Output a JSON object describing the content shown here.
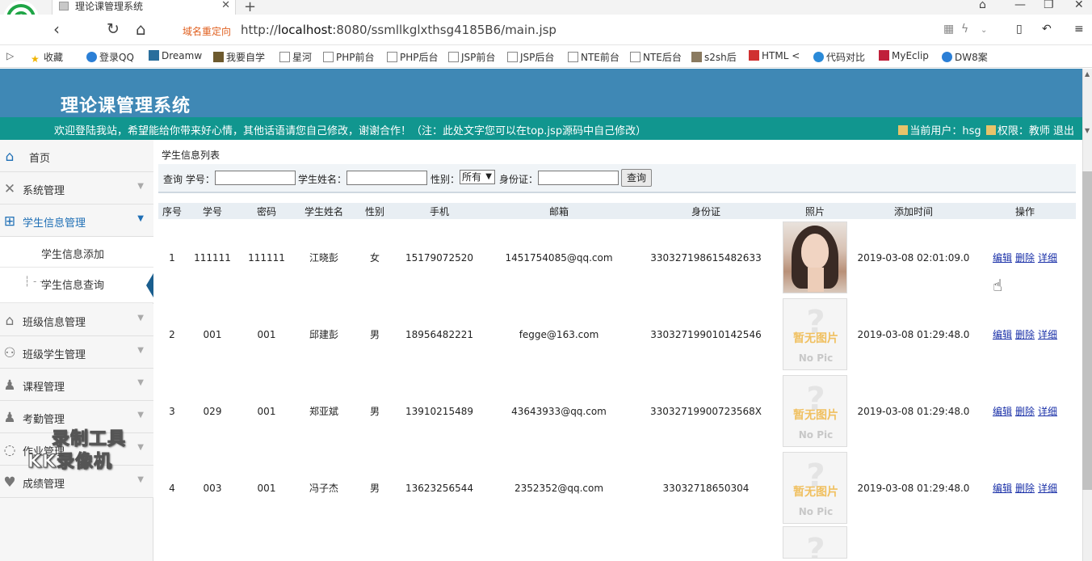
{
  "browser": {
    "tab_title": "理论课管理系统",
    "redirect_label": "域名重定向",
    "url_prefix": "http://",
    "url_host": "localhost",
    "url_rest": ":8080/ssmllkglxthsg4185B6/main.jsp",
    "bookmarks": [
      "收藏",
      "登录QQ",
      "Dreamw",
      "我要自学",
      "星河",
      "PHP前台",
      "PHP后台",
      "JSP前台",
      "JSP后台",
      "NTE前台",
      "NTE后台",
      "s2sh后",
      "HTML <",
      "代码对比",
      "MyEclip",
      "DW8案"
    ]
  },
  "header": {
    "title": "理论课管理系统",
    "welcome": "欢迎登陆我站，希望能给你带来好心情，其他话语请您自己修改，谢谢合作！（注：此处文字您可以在top.jsp源码中自己修改）",
    "current_user_label": "当前用户：hsg",
    "role_label": "权限：教师",
    "logout": "退出"
  },
  "sidebar": {
    "home": "首页",
    "items": [
      {
        "label": "系统管理",
        "icon": "tools-icon"
      },
      {
        "label": "学生信息管理",
        "icon": "grid-icon",
        "active": true
      },
      {
        "label": "班级信息管理",
        "icon": "home-icon"
      },
      {
        "label": "班级学生管理",
        "icon": "user-icon"
      },
      {
        "label": "课程管理",
        "icon": "person-icon"
      },
      {
        "label": "考勤管理",
        "icon": "person-icon"
      },
      {
        "label": "作业管理",
        "icon": "chat-icon"
      },
      {
        "label": "成绩管理",
        "icon": "heart-icon"
      }
    ],
    "subitems": [
      "学生信息添加",
      "学生信息查询"
    ],
    "watermark": [
      "录制工具",
      "KK录像机"
    ]
  },
  "main": {
    "list_title": "学生信息列表",
    "search": {
      "query_label": "查询 学号：",
      "name_label": "学生姓名：",
      "gender_label": "性别：",
      "gender_value": "所有",
      "id_label": "身份证：",
      "button": "查询"
    },
    "columns": [
      "序号",
      "学号",
      "密码",
      "学生姓名",
      "性别",
      "手机",
      "邮箱",
      "身份证",
      "照片",
      "添加时间",
      "操作"
    ],
    "rows": [
      {
        "no": "1",
        "sid": "111111",
        "pwd": "111111",
        "name": "江晓彭",
        "gender": "女",
        "phone": "15179072520",
        "email": "1451754085@qq.com",
        "idcard": "330327198615482633",
        "photo": "real",
        "time": "2019-03-08 02:01:09.0"
      },
      {
        "no": "2",
        "sid": "001",
        "pwd": "001",
        "name": "邱建彭",
        "gender": "男",
        "phone": "18956482221",
        "email": "fegge@163.com",
        "idcard": "330327199010142546",
        "photo": "none",
        "time": "2019-03-08 01:29:48.0"
      },
      {
        "no": "3",
        "sid": "029",
        "pwd": "001",
        "name": "郑亚斌",
        "gender": "男",
        "phone": "13910215489",
        "email": "43643933@qq.com",
        "idcard": "33032719900723568X",
        "photo": "none",
        "time": "2019-03-08 01:29:48.0"
      },
      {
        "no": "4",
        "sid": "003",
        "pwd": "001",
        "name": "冯子杰",
        "gender": "男",
        "phone": "13623256544",
        "email": "2352352@qq.com",
        "idcard": "330327186503​04",
        "photo": "none",
        "time": "2019-03-08 01:29:48.0"
      }
    ],
    "ops": [
      "编辑",
      "删除",
      "详细"
    ],
    "noimg": {
      "q": "?",
      "cn": "暂无图片",
      "en": "No Pic"
    }
  }
}
